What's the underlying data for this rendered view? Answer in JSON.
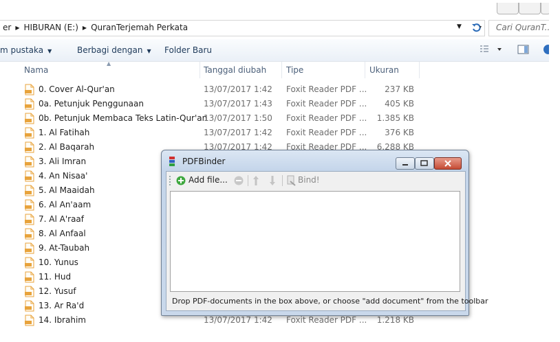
{
  "address": {
    "crumbs": [
      "er",
      "HIBURAN (E:)",
      "QuranTerjemah Perkata"
    ],
    "search_placeholder": "Cari QuranT..."
  },
  "toolbar": {
    "items": [
      "m pustaka",
      "Berbagi dengan",
      "Folder Baru"
    ]
  },
  "columns": {
    "name": "Nama",
    "date": "Tanggal diubah",
    "type": "Tipe",
    "size": "Ukuran"
  },
  "files": [
    {
      "name": "0. Cover Al-Qur'an",
      "date": "13/07/2017 1:42",
      "type": "Foxit Reader PDF ...",
      "size": "237 KB"
    },
    {
      "name": "0a. Petunjuk Penggunaan",
      "date": "13/07/2017 1:43",
      "type": "Foxit Reader PDF ...",
      "size": "405 KB"
    },
    {
      "name": "0b. Petunjuk Membaca Teks Latin-Qur'an",
      "date": "13/07/2017 1:50",
      "type": "Foxit Reader PDF ...",
      "size": "1.385 KB"
    },
    {
      "name": "1. Al Fatihah",
      "date": "13/07/2017 1:42",
      "type": "Foxit Reader PDF ...",
      "size": "376 KB"
    },
    {
      "name": "2. Al Baqarah",
      "date": "13/07/2017 1:42",
      "type": "Foxit Reader PDF ...",
      "size": "6.288 KB"
    },
    {
      "name": "3. Ali Imran",
      "date": "",
      "type": "",
      "size": ""
    },
    {
      "name": "4. An Nisaa'",
      "date": "",
      "type": "",
      "size": ""
    },
    {
      "name": "5. Al Maaidah",
      "date": "",
      "type": "",
      "size": ""
    },
    {
      "name": "6. Al An'aam",
      "date": "",
      "type": "",
      "size": ""
    },
    {
      "name": "7. Al A'raaf",
      "date": "",
      "type": "",
      "size": ""
    },
    {
      "name": "8. Al Anfaal",
      "date": "",
      "type": "",
      "size": ""
    },
    {
      "name": "9. At-Taubah",
      "date": "",
      "type": "",
      "size": ""
    },
    {
      "name": "10. Yunus",
      "date": "",
      "type": "",
      "size": ""
    },
    {
      "name": "11. Hud",
      "date": "",
      "type": "",
      "size": ""
    },
    {
      "name": "12. Yusuf",
      "date": "",
      "type": "",
      "size": ""
    },
    {
      "name": "13. Ar Ra'd",
      "date": "",
      "type": "",
      "size": ""
    },
    {
      "name": "14. Ibrahim",
      "date": "13/07/2017 1:42",
      "type": "Foxit Reader PDF ...",
      "size": "1.218 KB"
    }
  ],
  "dialog": {
    "title": "PDFBinder",
    "add_label": "Add file...",
    "bind_label": "Bind!",
    "status": "Drop PDF-documents in the box above, or choose \"add document\" from the toolbar"
  },
  "colors": {
    "pdf_icon": "#e8a33c",
    "accent": "#1e3a5a"
  }
}
